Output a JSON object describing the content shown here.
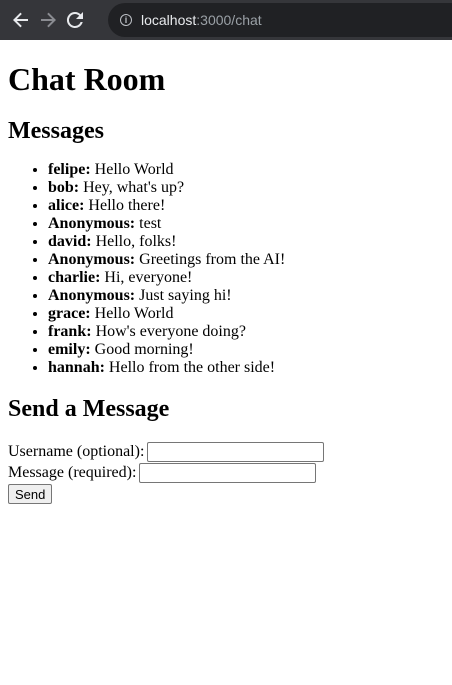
{
  "browser": {
    "url_host": "localhost",
    "url_path": ":3000/chat",
    "info_icon": "info-icon"
  },
  "page": {
    "title": "Chat Room",
    "messages_heading": "Messages",
    "send_heading": "Send a Message"
  },
  "messages": [
    {
      "sender": "felipe:",
      "text": " Hello World"
    },
    {
      "sender": "bob:",
      "text": " Hey, what's up?"
    },
    {
      "sender": "alice:",
      "text": " Hello there!"
    },
    {
      "sender": "Anonymous:",
      "text": " test"
    },
    {
      "sender": "david:",
      "text": " Hello, folks!"
    },
    {
      "sender": "Anonymous:",
      "text": " Greetings from the AI!"
    },
    {
      "sender": "charlie:",
      "text": " Hi, everyone!"
    },
    {
      "sender": "Anonymous:",
      "text": " Just saying hi!"
    },
    {
      "sender": "grace:",
      "text": " Hello World"
    },
    {
      "sender": "frank:",
      "text": " How's everyone doing?"
    },
    {
      "sender": "emily:",
      "text": " Good morning!"
    },
    {
      "sender": "hannah:",
      "text": " Hello from the other side!"
    }
  ],
  "form": {
    "username_label": "Username (optional):",
    "username_value": "",
    "message_label": "Message (required):",
    "message_value": "",
    "send_label": "Send"
  }
}
